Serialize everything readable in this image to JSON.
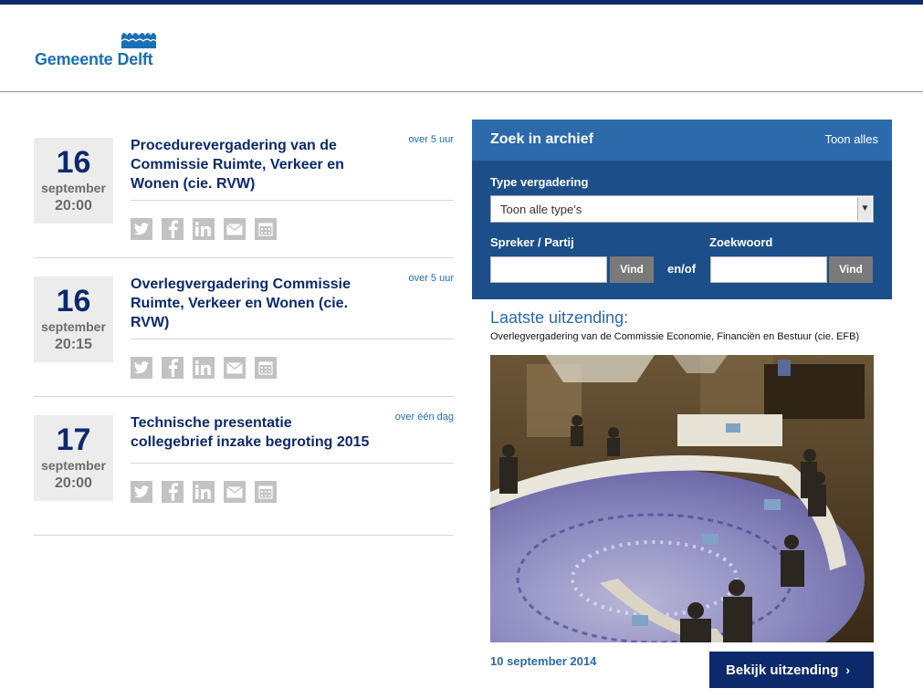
{
  "header": {
    "logo_text_1": "Gemeente",
    "logo_text_2": "Delft"
  },
  "events": [
    {
      "day": "16",
      "month": "september",
      "time": "20:00",
      "title": "Procedurevergadering van de Commissie Ruimte, Verkeer en Wonen (cie. RVW)",
      "when": "over 5 uur"
    },
    {
      "day": "16",
      "month": "september",
      "time": "20:15",
      "title": "Overlegvergadering Commissie Ruimte, Verkeer en Wonen (cie. RVW)",
      "when": "over 5 uur"
    },
    {
      "day": "17",
      "month": "september",
      "time": "20:00",
      "title": "Technische presentatie collegebrief inzake begroting 2015",
      "when": "over één dag"
    }
  ],
  "share_icons": [
    "twitter-icon",
    "facebook-icon",
    "linkedin-icon",
    "mail-icon",
    "calendar-icon"
  ],
  "search": {
    "title": "Zoek in archief",
    "show_all": "Toon alles",
    "type_label": "Type vergadering",
    "type_selected": "Toon alle type's",
    "speaker_label": "Spreker / Partij",
    "keyword_label": "Zoekwoord",
    "find_label": "Vind",
    "and_or": "en/of",
    "speaker_value": "",
    "keyword_value": ""
  },
  "latest": {
    "title": "Laatste uitzending:",
    "subtitle": "Overlegvergadering van de Commissie Economie, Financiën en Bestuur (cie. EFB)",
    "date": "10 september 2014",
    "watch_button": "Bekijk uitzending",
    "watch_chevron": "›"
  },
  "colors": {
    "brand_navy": "#0c2a6b",
    "brand_blue": "#1a6fb5",
    "panel_blue": "#1c4f8a",
    "panel_head": "#2c6aac",
    "share_grey": "#c2c2c2"
  }
}
